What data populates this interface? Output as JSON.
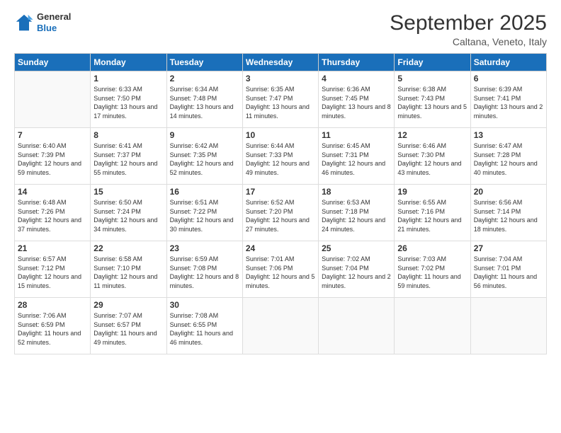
{
  "header": {
    "logo_general": "General",
    "logo_blue": "Blue",
    "main_title": "September 2025",
    "subtitle": "Caltana, Veneto, Italy"
  },
  "weekdays": [
    "Sunday",
    "Monday",
    "Tuesday",
    "Wednesday",
    "Thursday",
    "Friday",
    "Saturday"
  ],
  "weeks": [
    [
      {
        "day": "",
        "sunrise": "",
        "sunset": "",
        "daylight": ""
      },
      {
        "day": "1",
        "sunrise": "Sunrise: 6:33 AM",
        "sunset": "Sunset: 7:50 PM",
        "daylight": "Daylight: 13 hours and 17 minutes."
      },
      {
        "day": "2",
        "sunrise": "Sunrise: 6:34 AM",
        "sunset": "Sunset: 7:48 PM",
        "daylight": "Daylight: 13 hours and 14 minutes."
      },
      {
        "day": "3",
        "sunrise": "Sunrise: 6:35 AM",
        "sunset": "Sunset: 7:47 PM",
        "daylight": "Daylight: 13 hours and 11 minutes."
      },
      {
        "day": "4",
        "sunrise": "Sunrise: 6:36 AM",
        "sunset": "Sunset: 7:45 PM",
        "daylight": "Daylight: 13 hours and 8 minutes."
      },
      {
        "day": "5",
        "sunrise": "Sunrise: 6:38 AM",
        "sunset": "Sunset: 7:43 PM",
        "daylight": "Daylight: 13 hours and 5 minutes."
      },
      {
        "day": "6",
        "sunrise": "Sunrise: 6:39 AM",
        "sunset": "Sunset: 7:41 PM",
        "daylight": "Daylight: 13 hours and 2 minutes."
      }
    ],
    [
      {
        "day": "7",
        "sunrise": "Sunrise: 6:40 AM",
        "sunset": "Sunset: 7:39 PM",
        "daylight": "Daylight: 12 hours and 59 minutes."
      },
      {
        "day": "8",
        "sunrise": "Sunrise: 6:41 AM",
        "sunset": "Sunset: 7:37 PM",
        "daylight": "Daylight: 12 hours and 55 minutes."
      },
      {
        "day": "9",
        "sunrise": "Sunrise: 6:42 AM",
        "sunset": "Sunset: 7:35 PM",
        "daylight": "Daylight: 12 hours and 52 minutes."
      },
      {
        "day": "10",
        "sunrise": "Sunrise: 6:44 AM",
        "sunset": "Sunset: 7:33 PM",
        "daylight": "Daylight: 12 hours and 49 minutes."
      },
      {
        "day": "11",
        "sunrise": "Sunrise: 6:45 AM",
        "sunset": "Sunset: 7:31 PM",
        "daylight": "Daylight: 12 hours and 46 minutes."
      },
      {
        "day": "12",
        "sunrise": "Sunrise: 6:46 AM",
        "sunset": "Sunset: 7:30 PM",
        "daylight": "Daylight: 12 hours and 43 minutes."
      },
      {
        "day": "13",
        "sunrise": "Sunrise: 6:47 AM",
        "sunset": "Sunset: 7:28 PM",
        "daylight": "Daylight: 12 hours and 40 minutes."
      }
    ],
    [
      {
        "day": "14",
        "sunrise": "Sunrise: 6:48 AM",
        "sunset": "Sunset: 7:26 PM",
        "daylight": "Daylight: 12 hours and 37 minutes."
      },
      {
        "day": "15",
        "sunrise": "Sunrise: 6:50 AM",
        "sunset": "Sunset: 7:24 PM",
        "daylight": "Daylight: 12 hours and 34 minutes."
      },
      {
        "day": "16",
        "sunrise": "Sunrise: 6:51 AM",
        "sunset": "Sunset: 7:22 PM",
        "daylight": "Daylight: 12 hours and 30 minutes."
      },
      {
        "day": "17",
        "sunrise": "Sunrise: 6:52 AM",
        "sunset": "Sunset: 7:20 PM",
        "daylight": "Daylight: 12 hours and 27 minutes."
      },
      {
        "day": "18",
        "sunrise": "Sunrise: 6:53 AM",
        "sunset": "Sunset: 7:18 PM",
        "daylight": "Daylight: 12 hours and 24 minutes."
      },
      {
        "day": "19",
        "sunrise": "Sunrise: 6:55 AM",
        "sunset": "Sunset: 7:16 PM",
        "daylight": "Daylight: 12 hours and 21 minutes."
      },
      {
        "day": "20",
        "sunrise": "Sunrise: 6:56 AM",
        "sunset": "Sunset: 7:14 PM",
        "daylight": "Daylight: 12 hours and 18 minutes."
      }
    ],
    [
      {
        "day": "21",
        "sunrise": "Sunrise: 6:57 AM",
        "sunset": "Sunset: 7:12 PM",
        "daylight": "Daylight: 12 hours and 15 minutes."
      },
      {
        "day": "22",
        "sunrise": "Sunrise: 6:58 AM",
        "sunset": "Sunset: 7:10 PM",
        "daylight": "Daylight: 12 hours and 11 minutes."
      },
      {
        "day": "23",
        "sunrise": "Sunrise: 6:59 AM",
        "sunset": "Sunset: 7:08 PM",
        "daylight": "Daylight: 12 hours and 8 minutes."
      },
      {
        "day": "24",
        "sunrise": "Sunrise: 7:01 AM",
        "sunset": "Sunset: 7:06 PM",
        "daylight": "Daylight: 12 hours and 5 minutes."
      },
      {
        "day": "25",
        "sunrise": "Sunrise: 7:02 AM",
        "sunset": "Sunset: 7:04 PM",
        "daylight": "Daylight: 12 hours and 2 minutes."
      },
      {
        "day": "26",
        "sunrise": "Sunrise: 7:03 AM",
        "sunset": "Sunset: 7:02 PM",
        "daylight": "Daylight: 11 hours and 59 minutes."
      },
      {
        "day": "27",
        "sunrise": "Sunrise: 7:04 AM",
        "sunset": "Sunset: 7:01 PM",
        "daylight": "Daylight: 11 hours and 56 minutes."
      }
    ],
    [
      {
        "day": "28",
        "sunrise": "Sunrise: 7:06 AM",
        "sunset": "Sunset: 6:59 PM",
        "daylight": "Daylight: 11 hours and 52 minutes."
      },
      {
        "day": "29",
        "sunrise": "Sunrise: 7:07 AM",
        "sunset": "Sunset: 6:57 PM",
        "daylight": "Daylight: 11 hours and 49 minutes."
      },
      {
        "day": "30",
        "sunrise": "Sunrise: 7:08 AM",
        "sunset": "Sunset: 6:55 PM",
        "daylight": "Daylight: 11 hours and 46 minutes."
      },
      {
        "day": "",
        "sunrise": "",
        "sunset": "",
        "daylight": ""
      },
      {
        "day": "",
        "sunrise": "",
        "sunset": "",
        "daylight": ""
      },
      {
        "day": "",
        "sunrise": "",
        "sunset": "",
        "daylight": ""
      },
      {
        "day": "",
        "sunrise": "",
        "sunset": "",
        "daylight": ""
      }
    ]
  ]
}
